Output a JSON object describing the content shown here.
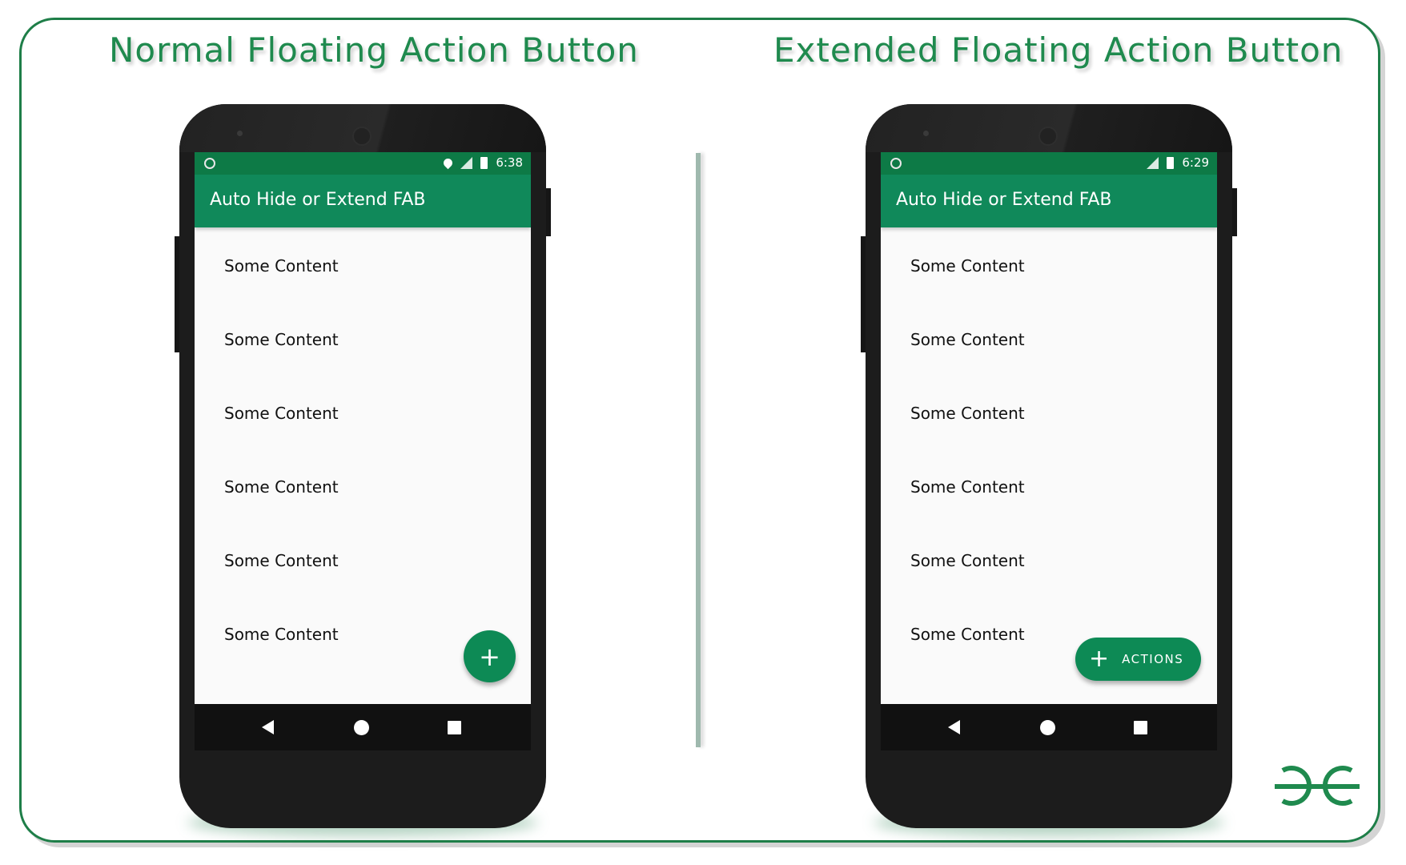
{
  "headings": {
    "left": "Normal Floating Action Button",
    "right": "Extended Floating Action Button"
  },
  "phones": [
    {
      "status_time": "6:38",
      "app_title": "Auto Hide or Extend FAB",
      "items": [
        "Some Content",
        "Some Content",
        "Some Content",
        "Some Content",
        "Some Content",
        "Some Content"
      ],
      "fab_icon": "+"
    },
    {
      "status_time": "6:29",
      "app_title": "Auto Hide or Extend FAB",
      "items": [
        "Some Content",
        "Some Content",
        "Some Content",
        "Some Content",
        "Some Content",
        "Some Content"
      ],
      "fab_icon": "+",
      "fab_label": "ACTIONS"
    }
  ],
  "colors": {
    "accent": "#1f8a4e",
    "app_bar": "#10895a",
    "status_bar": "#0d7a46",
    "fab": "#0d8a55"
  },
  "icons": {
    "status": [
      "circle-notification-icon",
      "location-pin-icon",
      "signal-icon",
      "battery-icon"
    ],
    "nav": [
      "back-icon",
      "home-icon",
      "recents-icon"
    ],
    "logo": "gfg-logo-icon"
  }
}
